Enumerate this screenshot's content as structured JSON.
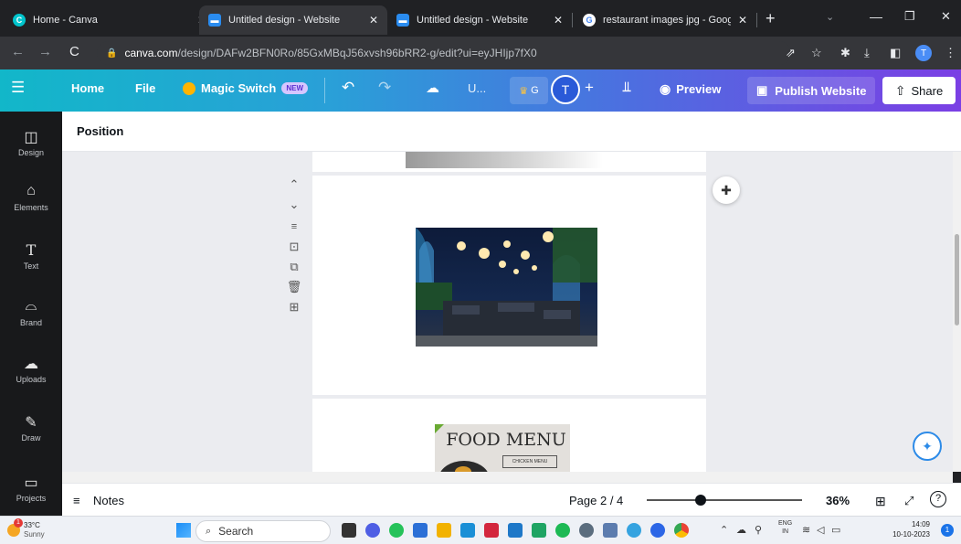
{
  "browser": {
    "tabs": [
      {
        "title": "Home - Canva",
        "active": false
      },
      {
        "title": "Untitled design - Website",
        "active": true
      },
      {
        "title": "Untitled design - Website",
        "active": false
      },
      {
        "title": "restaurant images jpg - Google S",
        "active": false
      }
    ],
    "url_domain": "canva.com",
    "url_path": "/design/DAFw2BFN0Ro/85GxMBqJ56xvsh96bRR2-g/edit?ui=eyJHIjp7fX0",
    "profile_letter": "T"
  },
  "canva_bar": {
    "home": "Home",
    "file": "File",
    "magic_switch": "Magic Switch",
    "new_badge": "NEW",
    "title_short": "U...",
    "crown_label": "G",
    "avatar_letter": "T",
    "preview": "Preview",
    "publish": "Publish Website",
    "share": "Share"
  },
  "rail": [
    {
      "label": "Design",
      "icon": "layout-icon"
    },
    {
      "label": "Elements",
      "icon": "shapes-icon"
    },
    {
      "label": "Text",
      "icon": "text-icon"
    },
    {
      "label": "Brand",
      "icon": "brand-icon"
    },
    {
      "label": "Uploads",
      "icon": "cloud-upload-icon"
    },
    {
      "label": "Draw",
      "icon": "pen-icon"
    },
    {
      "label": "Projects",
      "icon": "folder-icon"
    }
  ],
  "subbar": {
    "title": "Position"
  },
  "canvas": {
    "menu_title": "FOOD MENU",
    "menu_subtitle": "CHICKEN MENU"
  },
  "bottombar": {
    "notes": "Notes",
    "page_indicator": "Page 2 / 4",
    "zoom": "36%",
    "zoom_fraction": 0.36
  },
  "taskbar": {
    "weather_temp": "33°C",
    "weather_desc": "Sunny",
    "search": "Search",
    "lang_1": "ENG",
    "lang_2": "IN",
    "time": "14:09",
    "date": "10-10-2023",
    "notification_count": "1"
  },
  "colors": {
    "canva_gradient_start": "#12b7c9",
    "canva_gradient_end": "#7b3fe4",
    "rail_bg": "#18191b",
    "workspace_bg": "#ebecf0"
  }
}
